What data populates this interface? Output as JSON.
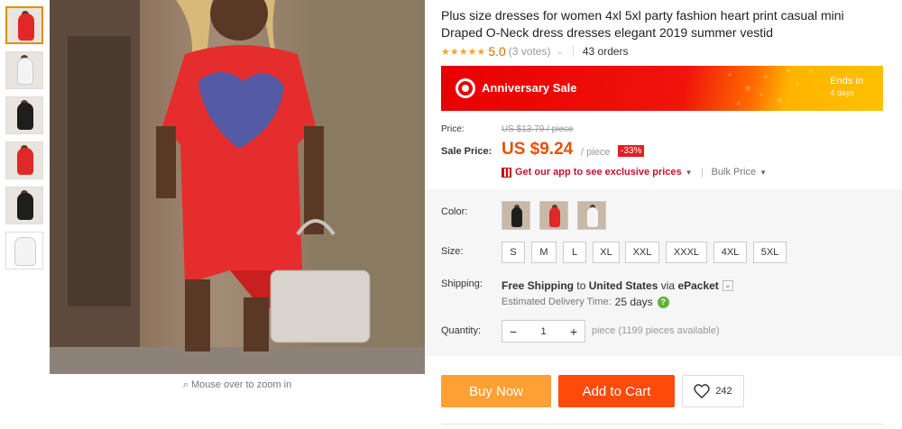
{
  "product": {
    "title": "Plus size dresses for women 4xl 5xl party fashion heart print casual mini Draped O-Neck dress dresses elegant 2019 summer vestid",
    "stars": "★★★★★",
    "rating": "5.0",
    "votes": "(3 votes)",
    "orders": "43 orders"
  },
  "gallery": {
    "zoom_hint": "Mouse over to zoom in",
    "thumbnails": [
      {
        "color": "#e02828",
        "active": true
      },
      {
        "color": "#f4f4f4",
        "active": false
      },
      {
        "color": "#1e1e1e",
        "active": false
      },
      {
        "color": "#e02828",
        "active": false
      },
      {
        "color": "#1e1e1e",
        "active": false
      },
      {
        "color": "#f4f4f4",
        "active": false
      }
    ]
  },
  "banner": {
    "title": "Anniversary Sale",
    "ends_label": "Ends in",
    "ends_value": "4 days"
  },
  "pricing": {
    "price_label": "Price:",
    "original_price": "US $13.79 / piece",
    "sale_label": "Sale Price:",
    "sale_price": "US $9.24",
    "per_piece": "/ piece",
    "discount": "-33%",
    "app_price_text": "Get our app to see exclusive prices",
    "bulk_price": "Bulk Price"
  },
  "options": {
    "color_label": "Color:",
    "colors": [
      "#1e1e1e",
      "#e02828",
      "#f4f4f4"
    ],
    "size_label": "Size:",
    "sizes": [
      "S",
      "M",
      "L",
      "XL",
      "XXL",
      "XXXL",
      "4XL",
      "5XL"
    ],
    "shipping_label": "Shipping:",
    "shipping_free": "Free Shipping",
    "shipping_to": "to",
    "shipping_country": "United States",
    "shipping_via": "via",
    "shipping_method": "ePacket",
    "delivery_label": "Estimated Delivery Time:",
    "delivery_days": "25 days",
    "quantity_label": "Quantity:",
    "quantity_value": "1",
    "quantity_minus": "−",
    "quantity_plus": "+",
    "availability": "piece (1199 pieces available)"
  },
  "actions": {
    "buy_now": "Buy Now",
    "add_to_cart": "Add to Cart",
    "wishlist_count": "242"
  },
  "colors": {
    "accent_orange": "#ff4a0a",
    "buy_now_orange": "#ffa034",
    "price_orange": "#e8500a",
    "sale_red": "#e80000"
  }
}
